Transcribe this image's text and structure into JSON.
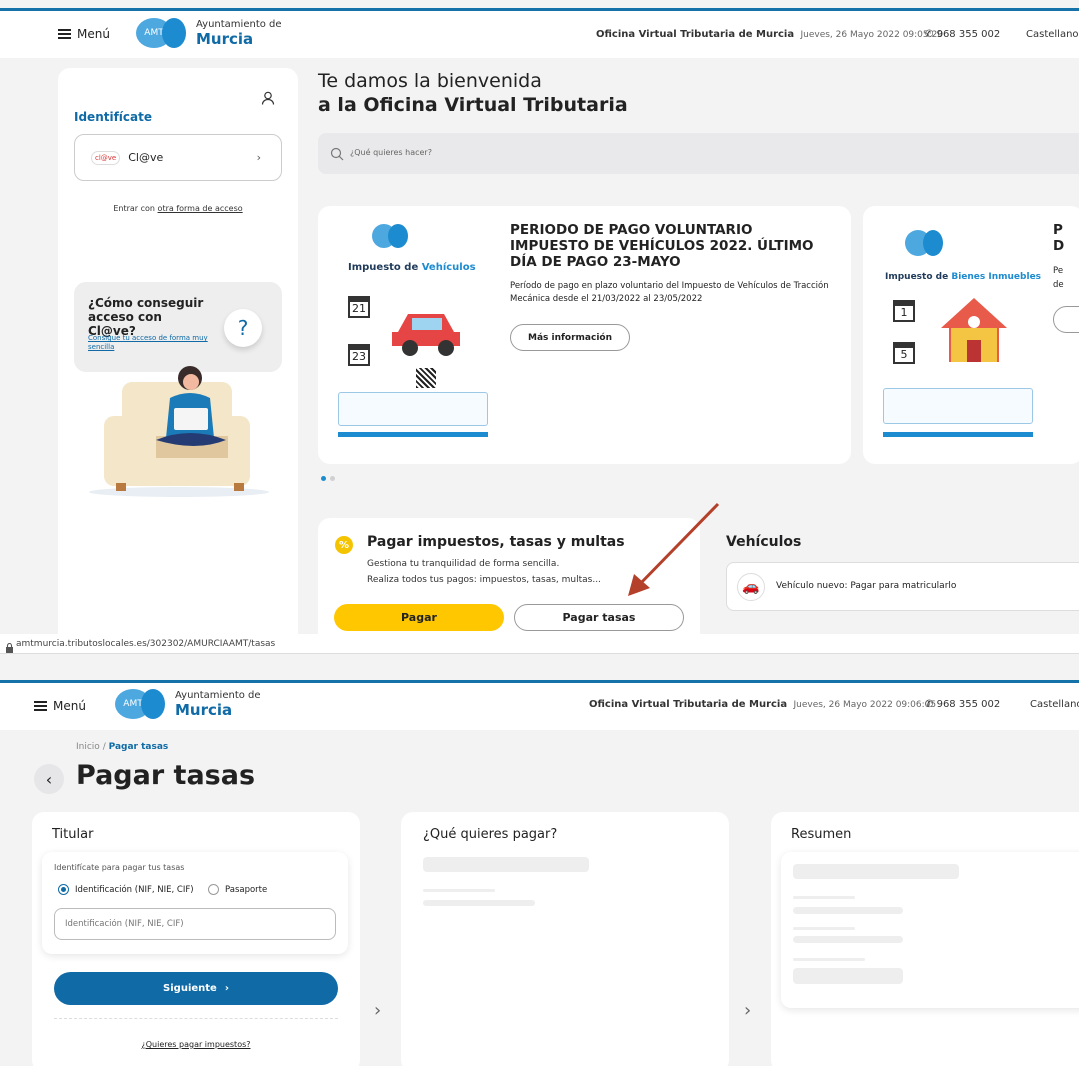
{
  "top": {
    "menu_label": "Menú",
    "logo_amt": "AMT",
    "logo_line1": "Ayuntamiento de",
    "logo_line2": "Murcia",
    "office": "Oficina Virtual Tributaria de Murcia",
    "datetime": "Jueves, 26 Mayo 2022 09:05:20",
    "phone": "968 355 002",
    "language": "Castellano",
    "login_title": "Identifícate",
    "clave_label": "Cl@ve",
    "clave_logo": "cl@ve",
    "alt_access_prefix": "Entrar con ",
    "alt_access_link": "otra forma de acceso",
    "help_title": "¿Cómo conseguir acceso con Cl@ve?",
    "help_link": "Consigue tu acceso de forma muy sencilla",
    "welcome_line1": "Te damos la bienvenida",
    "welcome_line2": "a la Oficina Virtual Tributaria",
    "search_placeholder": "¿Qué quieres hacer?",
    "banner_img_title_a": "Impuesto de ",
    "banner_img_title_b": "Vehículos",
    "banner_title": "PERIODO DE PAGO VOLUNTARIO IMPUESTO DE VEHÍCULOS 2022. ÚLTIMO DÍA DE PAGO 23-MAYO",
    "banner_text": "Período de pago en plazo voluntario del Impuesto de Vehículos de Tracción Mecánica desde el 21/03/2022 al 23/05/2022",
    "banner_btn": "Más información",
    "cal1": "21",
    "cal2": "23",
    "banner2_img_title_a": "Impuesto de ",
    "banner2_img_title_b": "Bienes Inmuebles",
    "banner2_title": "P D",
    "banner2_text": "Pe de",
    "cal3": "1",
    "cal4": "5",
    "pay_title": "Pagar impuestos, tasas y multas",
    "pay_text1": "Gestiona tu tranquilidad de forma sencilla.",
    "pay_text2": "Realiza todos tus pagos: impuestos, tasas, multas...",
    "pay_btn": "Pagar",
    "pay_tasas_btn": "Pagar tasas",
    "veh_title": "Vehículos",
    "veh_item": "Vehículo nuevo: Pagar para matricularlo"
  },
  "url": "amtmurcia.tributoslocales.es/302302/AMURCIAAMT/tasas",
  "bottom": {
    "menu_label": "Menú",
    "logo_amt": "AMT",
    "logo_line1": "Ayuntamiento de",
    "logo_line2": "Murcia",
    "office": "Oficina Virtual Tributaria de Murcia",
    "datetime": "Jueves, 26 Mayo 2022 09:06:05",
    "phone": "968 355 002",
    "language": "Castellano",
    "breadcrumb_home": "Inicio",
    "breadcrumb_sep": " / ",
    "breadcrumb_current": "Pagar tasas",
    "page_title": "Pagar tasas",
    "titular_title": "Titular",
    "id_hint": "Identifícate para pagar tus tasas",
    "radio1": "Identificación (NIF, NIE, CIF)",
    "radio2": "Pasaporte",
    "id_placeholder": "Identificación (NIF, NIE, CIF)",
    "next_btn": "Siguiente",
    "pay_taxes_link": "¿Quieres pagar impuestos?",
    "what_title": "¿Qué quieres pagar?",
    "summary_title": "Resumen"
  },
  "colors": {
    "brand_blue": "#0f6aa6",
    "yellow": "#ffc700",
    "arrow": "#b5402a"
  }
}
